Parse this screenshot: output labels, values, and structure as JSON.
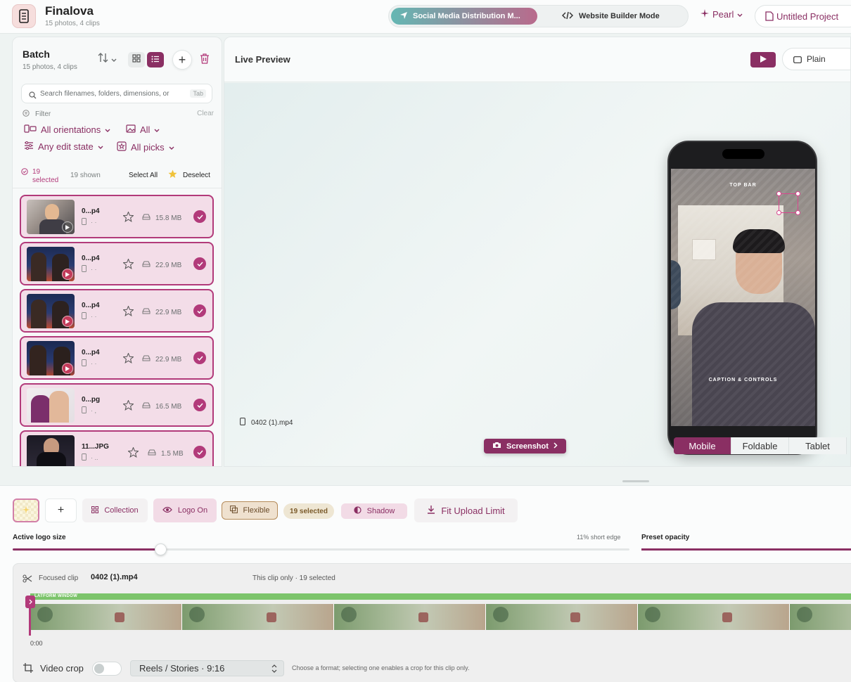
{
  "app": {
    "name": "Finalova",
    "subtitle": "15 photos, 4 clips",
    "modes": [
      {
        "label": "Social Media Distribution M...",
        "active": true
      },
      {
        "label": "Website Builder Mode",
        "active": false
      }
    ],
    "theme": "Pearl",
    "project": "Untitled Project"
  },
  "batch": {
    "title": "Batch",
    "subtitle": "15 photos, 4 clips",
    "search_placeholder": "Search filenames, folders, dimensions, or",
    "search_key": "Tab",
    "filter_label": "Filter",
    "filter_clear": "Clear",
    "filters": {
      "orientation": "All orientations",
      "media": "All",
      "edit_state": "Any edit state",
      "picks": "All picks"
    },
    "selected_count": "19",
    "selected_label": "selected",
    "shown": "19 shown",
    "select_all": "Select All",
    "deselect": "Deselect",
    "items": [
      {
        "name": "0...p4",
        "size": "15.8 MB",
        "video": true,
        "thumb": "photo-1"
      },
      {
        "name": "0...p4",
        "size": "22.9 MB",
        "video": true,
        "thumb": "photo-2"
      },
      {
        "name": "0...p4",
        "size": "22.9 MB",
        "video": true,
        "thumb": "photo-2"
      },
      {
        "name": "0...p4",
        "size": "22.9 MB",
        "video": true,
        "thumb": "photo-3"
      },
      {
        "name": "0...pg",
        "size": "16.5 MB",
        "video": false,
        "thumb": "photo-4"
      },
      {
        "name": "11...JPG",
        "size": "1.5 MB",
        "video": false,
        "thumb": "photo-5"
      }
    ]
  },
  "preview": {
    "title": "Live Preview",
    "plain_label": "Plain",
    "overlay_top": "TOP BAR",
    "overlay_caption": "CAPTION & CONTROLS",
    "file_name": "0402 (1).mp4",
    "screenshot_label": "Screenshot",
    "devices": [
      {
        "label": "Mobile",
        "active": true
      },
      {
        "label": "Foldable",
        "active": false
      },
      {
        "label": "Tablet",
        "active": false
      }
    ]
  },
  "toolbar": {
    "collection": "Collection",
    "logo": "Logo On",
    "flexible": "Flexible",
    "selected": "19 selected",
    "shadow": "Shadow",
    "fit": "Fit Upload Limit",
    "plus": "+"
  },
  "logo_size": {
    "label": "Active logo size",
    "value": "11% short edge",
    "fraction": 0.24
  },
  "opacity": {
    "label": "Preset opacity"
  },
  "timeline": {
    "focused_label": "Focused clip",
    "clip_name": "0402 (1).mp4",
    "scope": "This clip only · 19 selected",
    "platform_label": "LATFORM WINDOW",
    "time": "0:00",
    "video_crop_label": "Video crop",
    "format": "Reels / Stories · 9:16",
    "hint": "Choose a format; selecting one enables a crop for this clip only."
  },
  "colors": {
    "accent": "#8a2f63",
    "selected_border": "#b23a7a",
    "platform_green": "#7cc46b"
  }
}
